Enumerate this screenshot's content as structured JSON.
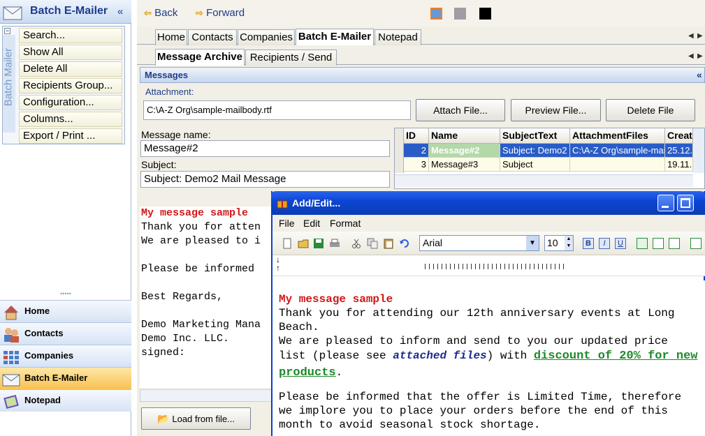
{
  "left_pane": {
    "title": "Batch E-Mailer",
    "collapse": "«",
    "vertical_label": "Batch Mailer",
    "menu": [
      "Search...",
      "Show All",
      "Delete All",
      "Recipients Group...",
      "Configuration...",
      "Columns...",
      "Export / Print ..."
    ],
    "nav": [
      "Home",
      "Contacts",
      "Companies",
      "Batch E-Mailer",
      "Notepad"
    ]
  },
  "toolbar": {
    "back": "Back",
    "forward": "Forward",
    "colors": [
      "#6d97d4",
      "#9f9ca4",
      "#000000"
    ]
  },
  "main_tabs": [
    "Home",
    "Contacts",
    "Companies",
    "Batch E-Mailer",
    "Notepad"
  ],
  "sub_tabs": [
    "Message Archive",
    "Recipients / Send"
  ],
  "messages": {
    "header": "Messages",
    "collapse": "«",
    "attachment_label": "Attachment:",
    "attachment_value": "C:\\A-Z Org\\sample-mailbody.rtf",
    "attach_btn": "Attach File...",
    "preview_btn": "Preview File...",
    "delete_btn": "Delete File",
    "name_label": "Message name:",
    "name_value": "Message#2",
    "subject_label": "Subject:",
    "subject_value": "Subject: Demo2 Mail Message"
  },
  "grid": {
    "columns": [
      "ID",
      "Name",
      "SubjectText",
      "AttachmentFiles",
      "Create"
    ],
    "rows": [
      [
        "2",
        "Message#2",
        "Subject: Demo2",
        "C:\\A-Z Org\\sample-mai",
        "25.12."
      ],
      [
        "3",
        "Message#3",
        "Subject",
        "",
        "19.11."
      ]
    ]
  },
  "body_text": {
    "title": "My message sample",
    "lines": [
      "Thank you for atten",
      "We are pleased to i",
      "",
      "Please be informed",
      "",
      "Best Regards,",
      "",
      "Demo Marketing Mana",
      "Demo Inc. LLC.",
      "signed:"
    ]
  },
  "load_btn": "Load from file...",
  "dialog": {
    "title": "Add/Edit...",
    "menu": [
      "File",
      "Edit",
      "Format"
    ],
    "font": "Arial",
    "size": "10",
    "doc": {
      "title": "My message sample",
      "p1": "Thank you for attending our 12th anniversary events at Long Beach.",
      "p2a": "We are pleased to inform and send to you our updated price list (please see ",
      "p2b": "attached files",
      "p2c": ") with ",
      "p2d": "discount of 20% for new products",
      "p2e": ".",
      "p3": "Please be informed that the offer is Limited Time, therefore we implore you to place your orders before the end of this month to avoid seasonal stock shortage."
    }
  }
}
